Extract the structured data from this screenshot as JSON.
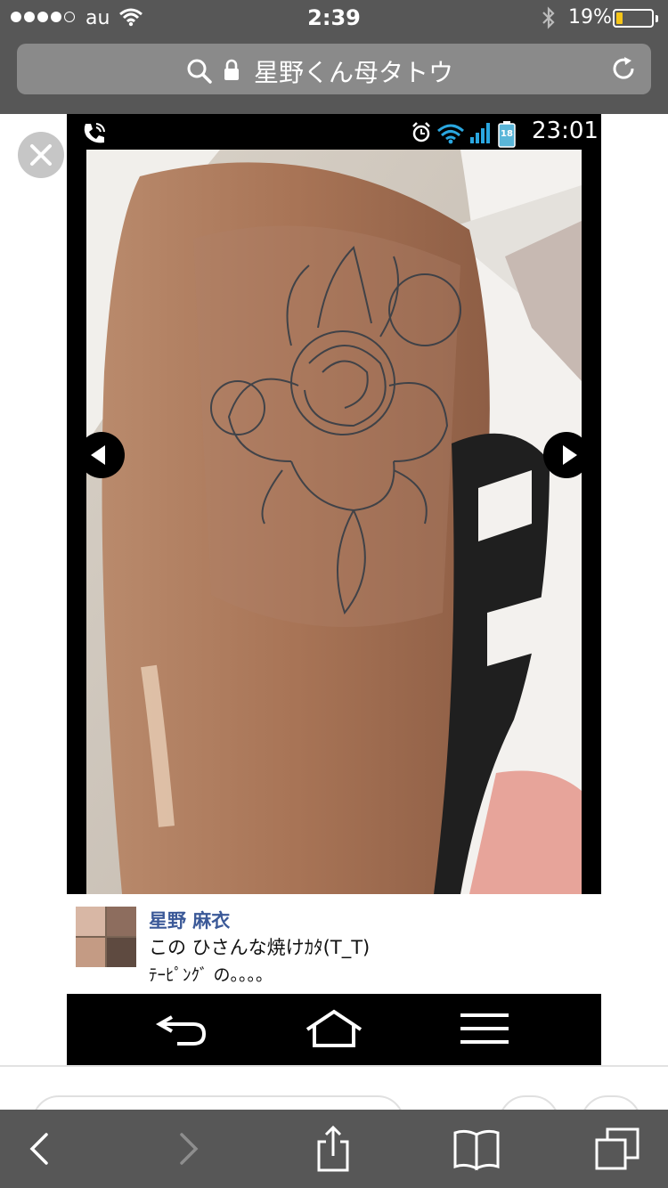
{
  "status_bar": {
    "carrier": "au",
    "time": "2:39",
    "battery_percent": "19%",
    "battery_level": 0.19,
    "signal_bars": 4
  },
  "url_bar": {
    "text": "星野くん母タトウ"
  },
  "embedded_phone": {
    "time": "23:01",
    "battery_label": "18"
  },
  "post": {
    "author": "星野 麻衣",
    "line1": "この ひさんな焼けｶﾀ(T_T)",
    "line2": "ﾃｰﾋﾟﾝｸﾞ の。。。。"
  },
  "icons": {
    "url_bar": [
      "search-icon",
      "lock-icon",
      "reload-icon"
    ],
    "embedded_status": [
      "call-icon",
      "alarm-icon",
      "wifi-icon",
      "signal-icon",
      "battery-icon"
    ],
    "overlay": [
      "close-icon",
      "prev-arrow-icon",
      "next-arrow-icon"
    ],
    "embedded_nav": [
      "back-icon",
      "home-icon",
      "menu-icon"
    ],
    "toolbar": [
      "back-icon",
      "forward-icon",
      "share-icon",
      "bookmarks-icon",
      "tabs-icon"
    ]
  },
  "colors": {
    "chrome": "#575757",
    "battery_fill": "#f5c518",
    "author_name": "#3b5998"
  }
}
